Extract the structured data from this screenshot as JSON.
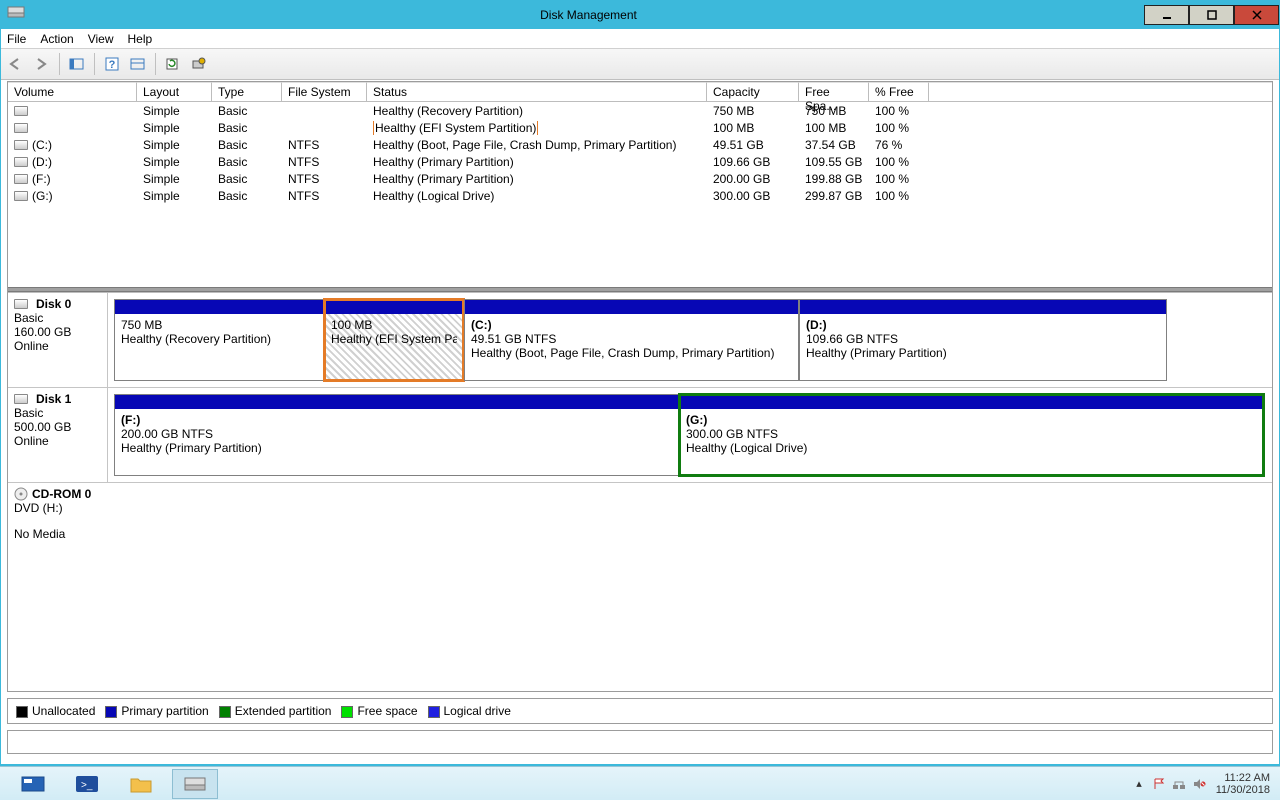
{
  "window": {
    "title": "Disk Management"
  },
  "menus": {
    "file": "File",
    "action": "Action",
    "view": "View",
    "help": "Help"
  },
  "columns": {
    "volume": "Volume",
    "layout": "Layout",
    "type": "Type",
    "fs": "File System",
    "status": "Status",
    "capacity": "Capacity",
    "free": "Free Spa...",
    "pfree": "% Free"
  },
  "volumes": [
    {
      "name": "",
      "layout": "Simple",
      "type": "Basic",
      "fs": "",
      "status": "Healthy (Recovery Partition)",
      "cap": "750 MB",
      "free": "750 MB",
      "pfree": "100 %",
      "highlight": false
    },
    {
      "name": "",
      "layout": "Simple",
      "type": "Basic",
      "fs": "",
      "status": "Healthy (EFI System Partition)",
      "cap": "100 MB",
      "free": "100 MB",
      "pfree": "100 %",
      "highlight": true
    },
    {
      "name": "(C:)",
      "layout": "Simple",
      "type": "Basic",
      "fs": "NTFS",
      "status": "Healthy (Boot, Page File, Crash Dump, Primary Partition)",
      "cap": "49.51 GB",
      "free": "37.54 GB",
      "pfree": "76 %",
      "highlight": false
    },
    {
      "name": "(D:)",
      "layout": "Simple",
      "type": "Basic",
      "fs": "NTFS",
      "status": "Healthy (Primary Partition)",
      "cap": "109.66 GB",
      "free": "109.55 GB",
      "pfree": "100 %",
      "highlight": false
    },
    {
      "name": "(F:)",
      "layout": "Simple",
      "type": "Basic",
      "fs": "NTFS",
      "status": "Healthy (Primary Partition)",
      "cap": "200.00 GB",
      "free": "199.88 GB",
      "pfree": "100 %",
      "highlight": false
    },
    {
      "name": "(G:)",
      "layout": "Simple",
      "type": "Basic",
      "fs": "NTFS",
      "status": "Healthy (Logical Drive)",
      "cap": "300.00 GB",
      "free": "299.87 GB",
      "pfree": "100 %",
      "highlight": false
    }
  ],
  "disks": {
    "d0": {
      "name": "Disk 0",
      "type": "Basic",
      "size": "160.00 GB",
      "state": "Online",
      "p0": {
        "line1": "",
        "line2": "750 MB",
        "line3": "Healthy (Recovery Partition)"
      },
      "p1": {
        "line1": "",
        "line2": "100 MB",
        "line3": "Healthy (EFI System Partition)"
      },
      "p2": {
        "line1": "(C:)",
        "line2": "49.51 GB NTFS",
        "line3": "Healthy (Boot, Page File, Crash Dump, Primary Partition)"
      },
      "p3": {
        "line1": "(D:)",
        "line2": "109.66 GB NTFS",
        "line3": "Healthy (Primary Partition)"
      }
    },
    "d1": {
      "name": "Disk 1",
      "type": "Basic",
      "size": "500.00 GB",
      "state": "Online",
      "p0": {
        "line1": "(F:)",
        "line2": "200.00 GB NTFS",
        "line3": "Healthy (Primary Partition)"
      },
      "p1": {
        "line1": "(G:)",
        "line2": "300.00 GB NTFS",
        "line3": "Healthy (Logical Drive)"
      }
    },
    "cd": {
      "name": "CD-ROM 0",
      "type": "DVD (H:)",
      "state": "No Media"
    }
  },
  "legend": {
    "unalloc": "Unallocated",
    "primary": "Primary partition",
    "extended": "Extended partition",
    "free": "Free space",
    "logical": "Logical drive"
  },
  "tray": {
    "time": "11:22 AM",
    "date": "11/30/2018"
  }
}
